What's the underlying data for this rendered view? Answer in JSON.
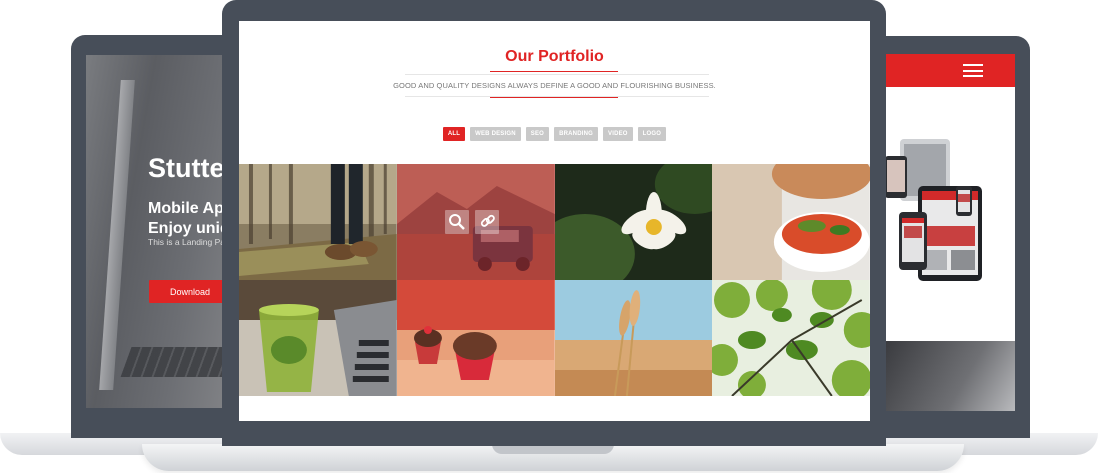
{
  "left_device": {
    "hero_title": "Stutte",
    "hero_line1": "Mobile App",
    "hero_line2": "Enjoy uniqu",
    "hero_small": "This is a Landing Pa",
    "download_label": "Download"
  },
  "center_device": {
    "section_title": "Our Portfolio",
    "tagline": "GOOD AND QUALITY DESIGNS ALWAYS DEFINE A GOOD AND FLOURISHING BUSINESS.",
    "filters": [
      {
        "label": "ALL",
        "active": true
      },
      {
        "label": "WEB DESIGN",
        "active": false
      },
      {
        "label": "SEO",
        "active": false
      },
      {
        "label": "BRANDING",
        "active": false
      },
      {
        "label": "VIDEO",
        "active": false
      },
      {
        "label": "LOGO",
        "active": false
      }
    ],
    "portfolio_items": [
      {
        "subject": "hiker boots on log",
        "hover": false
      },
      {
        "subject": "mountain road with van",
        "hover": true,
        "hover_icons": [
          "search-icon",
          "link-icon"
        ]
      },
      {
        "subject": "white water lily",
        "hover": false
      },
      {
        "subject": "salad bowl",
        "hover": false
      },
      {
        "subject": "mojito glass and laptop",
        "hover": false
      },
      {
        "subject": "cupcakes",
        "hover": false
      },
      {
        "subject": "wheat ears",
        "hover": false
      },
      {
        "subject": "tree canopy",
        "hover": false
      }
    ]
  },
  "right_device": {
    "menu_icon": "hamburger-icon"
  },
  "colors": {
    "accent": "#e02424",
    "device_frame": "#474e59",
    "filter_inactive": "#c9c9c9"
  }
}
